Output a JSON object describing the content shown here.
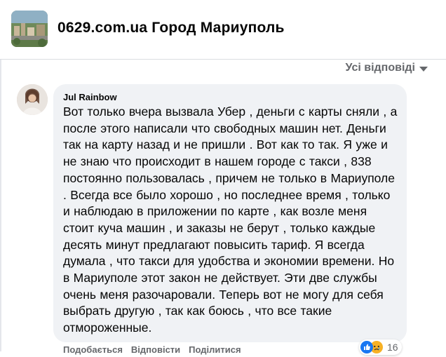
{
  "header": {
    "page_name": "0629.com.ua Город Мариуполь",
    "avatar_icon": "city-photo-icon"
  },
  "filter": {
    "label": "Усі відповіді",
    "caret_icon": "caret-down-icon"
  },
  "comment": {
    "author": "Jul Rainbow",
    "avatar_icon": "user-avatar-icon",
    "text": "Вот только вчера вызвала Убер , деньги с карты сняли , а после этого написали что свободных машин нет. Деньги так на карту назад и не пришли . Вот как то так. Я уже и не знаю что происходит в нашем городе с такси , 838 постоянно пользовалась , причем не только в Мариуполе . Всегда все было хорошо , но последнее время , только и наблюдаю в приложении по карте , как возле меня стоит куча машин , и заказы не берут , только каждые десять минут предлагают повысить тариф. Я всегда думала , что такси для удобства и экономии времени. Но в Мариуполе этот закон не действует. Эти две службы очень меня разочаровали. Теперь вот не могу для себя выбрать другую , так как боюсь , что все такие отмороженные.",
    "reactions": {
      "icons": [
        "like-icon",
        "sad-icon"
      ],
      "count": "16"
    },
    "actions": [
      "Подобається",
      "Відповісти",
      "Поділитися"
    ]
  },
  "colors": {
    "bubble_bg": "#f0f2f5",
    "secondary_text": "#65676b",
    "like_blue": "#1877f2",
    "sad_yellow": "#f7b125"
  }
}
